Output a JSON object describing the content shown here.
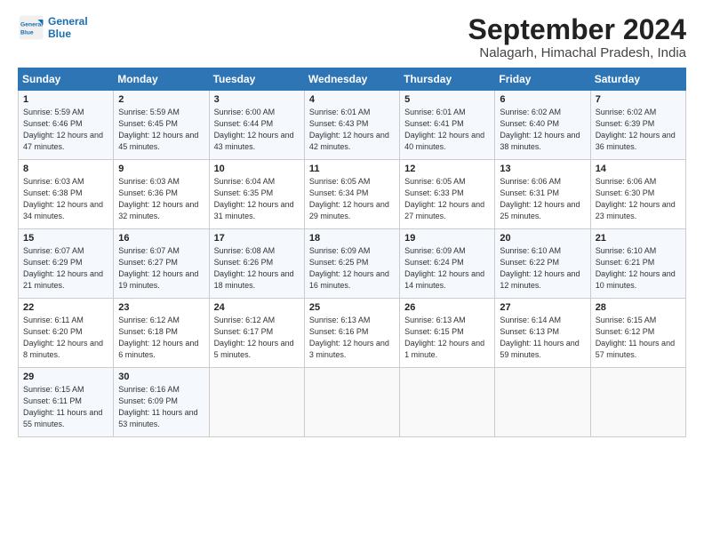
{
  "logo": {
    "line1": "General",
    "line2": "Blue"
  },
  "title": "September 2024",
  "location": "Nalagarh, Himachal Pradesh, India",
  "days_header": [
    "Sunday",
    "Monday",
    "Tuesday",
    "Wednesday",
    "Thursday",
    "Friday",
    "Saturday"
  ],
  "weeks": [
    [
      {
        "day": "1",
        "sunrise": "5:59 AM",
        "sunset": "6:46 PM",
        "daylight": "12 hours and 47 minutes."
      },
      {
        "day": "2",
        "sunrise": "5:59 AM",
        "sunset": "6:45 PM",
        "daylight": "12 hours and 45 minutes."
      },
      {
        "day": "3",
        "sunrise": "6:00 AM",
        "sunset": "6:44 PM",
        "daylight": "12 hours and 43 minutes."
      },
      {
        "day": "4",
        "sunrise": "6:01 AM",
        "sunset": "6:43 PM",
        "daylight": "12 hours and 42 minutes."
      },
      {
        "day": "5",
        "sunrise": "6:01 AM",
        "sunset": "6:41 PM",
        "daylight": "12 hours and 40 minutes."
      },
      {
        "day": "6",
        "sunrise": "6:02 AM",
        "sunset": "6:40 PM",
        "daylight": "12 hours and 38 minutes."
      },
      {
        "day": "7",
        "sunrise": "6:02 AM",
        "sunset": "6:39 PM",
        "daylight": "12 hours and 36 minutes."
      }
    ],
    [
      {
        "day": "8",
        "sunrise": "6:03 AM",
        "sunset": "6:38 PM",
        "daylight": "12 hours and 34 minutes."
      },
      {
        "day": "9",
        "sunrise": "6:03 AM",
        "sunset": "6:36 PM",
        "daylight": "12 hours and 32 minutes."
      },
      {
        "day": "10",
        "sunrise": "6:04 AM",
        "sunset": "6:35 PM",
        "daylight": "12 hours and 31 minutes."
      },
      {
        "day": "11",
        "sunrise": "6:05 AM",
        "sunset": "6:34 PM",
        "daylight": "12 hours and 29 minutes."
      },
      {
        "day": "12",
        "sunrise": "6:05 AM",
        "sunset": "6:33 PM",
        "daylight": "12 hours and 27 minutes."
      },
      {
        "day": "13",
        "sunrise": "6:06 AM",
        "sunset": "6:31 PM",
        "daylight": "12 hours and 25 minutes."
      },
      {
        "day": "14",
        "sunrise": "6:06 AM",
        "sunset": "6:30 PM",
        "daylight": "12 hours and 23 minutes."
      }
    ],
    [
      {
        "day": "15",
        "sunrise": "6:07 AM",
        "sunset": "6:29 PM",
        "daylight": "12 hours and 21 minutes."
      },
      {
        "day": "16",
        "sunrise": "6:07 AM",
        "sunset": "6:27 PM",
        "daylight": "12 hours and 19 minutes."
      },
      {
        "day": "17",
        "sunrise": "6:08 AM",
        "sunset": "6:26 PM",
        "daylight": "12 hours and 18 minutes."
      },
      {
        "day": "18",
        "sunrise": "6:09 AM",
        "sunset": "6:25 PM",
        "daylight": "12 hours and 16 minutes."
      },
      {
        "day": "19",
        "sunrise": "6:09 AM",
        "sunset": "6:24 PM",
        "daylight": "12 hours and 14 minutes."
      },
      {
        "day": "20",
        "sunrise": "6:10 AM",
        "sunset": "6:22 PM",
        "daylight": "12 hours and 12 minutes."
      },
      {
        "day": "21",
        "sunrise": "6:10 AM",
        "sunset": "6:21 PM",
        "daylight": "12 hours and 10 minutes."
      }
    ],
    [
      {
        "day": "22",
        "sunrise": "6:11 AM",
        "sunset": "6:20 PM",
        "daylight": "12 hours and 8 minutes."
      },
      {
        "day": "23",
        "sunrise": "6:12 AM",
        "sunset": "6:18 PM",
        "daylight": "12 hours and 6 minutes."
      },
      {
        "day": "24",
        "sunrise": "6:12 AM",
        "sunset": "6:17 PM",
        "daylight": "12 hours and 5 minutes."
      },
      {
        "day": "25",
        "sunrise": "6:13 AM",
        "sunset": "6:16 PM",
        "daylight": "12 hours and 3 minutes."
      },
      {
        "day": "26",
        "sunrise": "6:13 AM",
        "sunset": "6:15 PM",
        "daylight": "12 hours and 1 minute."
      },
      {
        "day": "27",
        "sunrise": "6:14 AM",
        "sunset": "6:13 PM",
        "daylight": "11 hours and 59 minutes."
      },
      {
        "day": "28",
        "sunrise": "6:15 AM",
        "sunset": "6:12 PM",
        "daylight": "11 hours and 57 minutes."
      }
    ],
    [
      {
        "day": "29",
        "sunrise": "6:15 AM",
        "sunset": "6:11 PM",
        "daylight": "11 hours and 55 minutes."
      },
      {
        "day": "30",
        "sunrise": "6:16 AM",
        "sunset": "6:09 PM",
        "daylight": "11 hours and 53 minutes."
      },
      {
        "day": "",
        "sunrise": "",
        "sunset": "",
        "daylight": ""
      },
      {
        "day": "",
        "sunrise": "",
        "sunset": "",
        "daylight": ""
      },
      {
        "day": "",
        "sunrise": "",
        "sunset": "",
        "daylight": ""
      },
      {
        "day": "",
        "sunrise": "",
        "sunset": "",
        "daylight": ""
      },
      {
        "day": "",
        "sunrise": "",
        "sunset": "",
        "daylight": ""
      }
    ]
  ]
}
